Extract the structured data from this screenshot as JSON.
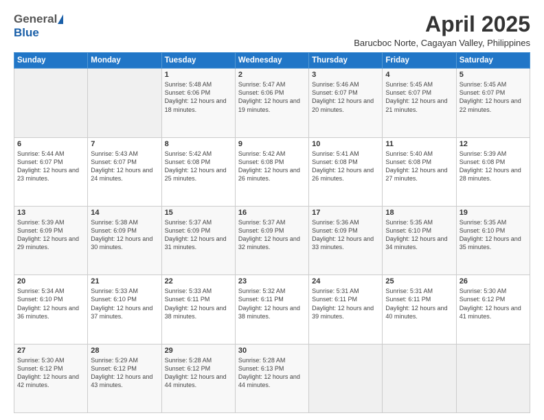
{
  "logo": {
    "general": "General",
    "blue": "Blue"
  },
  "header": {
    "month": "April 2025",
    "location": "Barucboc Norte, Cagayan Valley, Philippines"
  },
  "days_of_week": [
    "Sunday",
    "Monday",
    "Tuesday",
    "Wednesday",
    "Thursday",
    "Friday",
    "Saturday"
  ],
  "weeks": [
    [
      {
        "day": "",
        "info": ""
      },
      {
        "day": "",
        "info": ""
      },
      {
        "day": "1",
        "info": "Sunrise: 5:48 AM\nSunset: 6:06 PM\nDaylight: 12 hours and 18 minutes."
      },
      {
        "day": "2",
        "info": "Sunrise: 5:47 AM\nSunset: 6:06 PM\nDaylight: 12 hours and 19 minutes."
      },
      {
        "day": "3",
        "info": "Sunrise: 5:46 AM\nSunset: 6:07 PM\nDaylight: 12 hours and 20 minutes."
      },
      {
        "day": "4",
        "info": "Sunrise: 5:45 AM\nSunset: 6:07 PM\nDaylight: 12 hours and 21 minutes."
      },
      {
        "day": "5",
        "info": "Sunrise: 5:45 AM\nSunset: 6:07 PM\nDaylight: 12 hours and 22 minutes."
      }
    ],
    [
      {
        "day": "6",
        "info": "Sunrise: 5:44 AM\nSunset: 6:07 PM\nDaylight: 12 hours and 23 minutes."
      },
      {
        "day": "7",
        "info": "Sunrise: 5:43 AM\nSunset: 6:07 PM\nDaylight: 12 hours and 24 minutes."
      },
      {
        "day": "8",
        "info": "Sunrise: 5:42 AM\nSunset: 6:08 PM\nDaylight: 12 hours and 25 minutes."
      },
      {
        "day": "9",
        "info": "Sunrise: 5:42 AM\nSunset: 6:08 PM\nDaylight: 12 hours and 26 minutes."
      },
      {
        "day": "10",
        "info": "Sunrise: 5:41 AM\nSunset: 6:08 PM\nDaylight: 12 hours and 26 minutes."
      },
      {
        "day": "11",
        "info": "Sunrise: 5:40 AM\nSunset: 6:08 PM\nDaylight: 12 hours and 27 minutes."
      },
      {
        "day": "12",
        "info": "Sunrise: 5:39 AM\nSunset: 6:08 PM\nDaylight: 12 hours and 28 minutes."
      }
    ],
    [
      {
        "day": "13",
        "info": "Sunrise: 5:39 AM\nSunset: 6:09 PM\nDaylight: 12 hours and 29 minutes."
      },
      {
        "day": "14",
        "info": "Sunrise: 5:38 AM\nSunset: 6:09 PM\nDaylight: 12 hours and 30 minutes."
      },
      {
        "day": "15",
        "info": "Sunrise: 5:37 AM\nSunset: 6:09 PM\nDaylight: 12 hours and 31 minutes."
      },
      {
        "day": "16",
        "info": "Sunrise: 5:37 AM\nSunset: 6:09 PM\nDaylight: 12 hours and 32 minutes."
      },
      {
        "day": "17",
        "info": "Sunrise: 5:36 AM\nSunset: 6:09 PM\nDaylight: 12 hours and 33 minutes."
      },
      {
        "day": "18",
        "info": "Sunrise: 5:35 AM\nSunset: 6:10 PM\nDaylight: 12 hours and 34 minutes."
      },
      {
        "day": "19",
        "info": "Sunrise: 5:35 AM\nSunset: 6:10 PM\nDaylight: 12 hours and 35 minutes."
      }
    ],
    [
      {
        "day": "20",
        "info": "Sunrise: 5:34 AM\nSunset: 6:10 PM\nDaylight: 12 hours and 36 minutes."
      },
      {
        "day": "21",
        "info": "Sunrise: 5:33 AM\nSunset: 6:10 PM\nDaylight: 12 hours and 37 minutes."
      },
      {
        "day": "22",
        "info": "Sunrise: 5:33 AM\nSunset: 6:11 PM\nDaylight: 12 hours and 38 minutes."
      },
      {
        "day": "23",
        "info": "Sunrise: 5:32 AM\nSunset: 6:11 PM\nDaylight: 12 hours and 38 minutes."
      },
      {
        "day": "24",
        "info": "Sunrise: 5:31 AM\nSunset: 6:11 PM\nDaylight: 12 hours and 39 minutes."
      },
      {
        "day": "25",
        "info": "Sunrise: 5:31 AM\nSunset: 6:11 PM\nDaylight: 12 hours and 40 minutes."
      },
      {
        "day": "26",
        "info": "Sunrise: 5:30 AM\nSunset: 6:12 PM\nDaylight: 12 hours and 41 minutes."
      }
    ],
    [
      {
        "day": "27",
        "info": "Sunrise: 5:30 AM\nSunset: 6:12 PM\nDaylight: 12 hours and 42 minutes."
      },
      {
        "day": "28",
        "info": "Sunrise: 5:29 AM\nSunset: 6:12 PM\nDaylight: 12 hours and 43 minutes."
      },
      {
        "day": "29",
        "info": "Sunrise: 5:28 AM\nSunset: 6:12 PM\nDaylight: 12 hours and 44 minutes."
      },
      {
        "day": "30",
        "info": "Sunrise: 5:28 AM\nSunset: 6:13 PM\nDaylight: 12 hours and 44 minutes."
      },
      {
        "day": "",
        "info": ""
      },
      {
        "day": "",
        "info": ""
      },
      {
        "day": "",
        "info": ""
      }
    ]
  ]
}
